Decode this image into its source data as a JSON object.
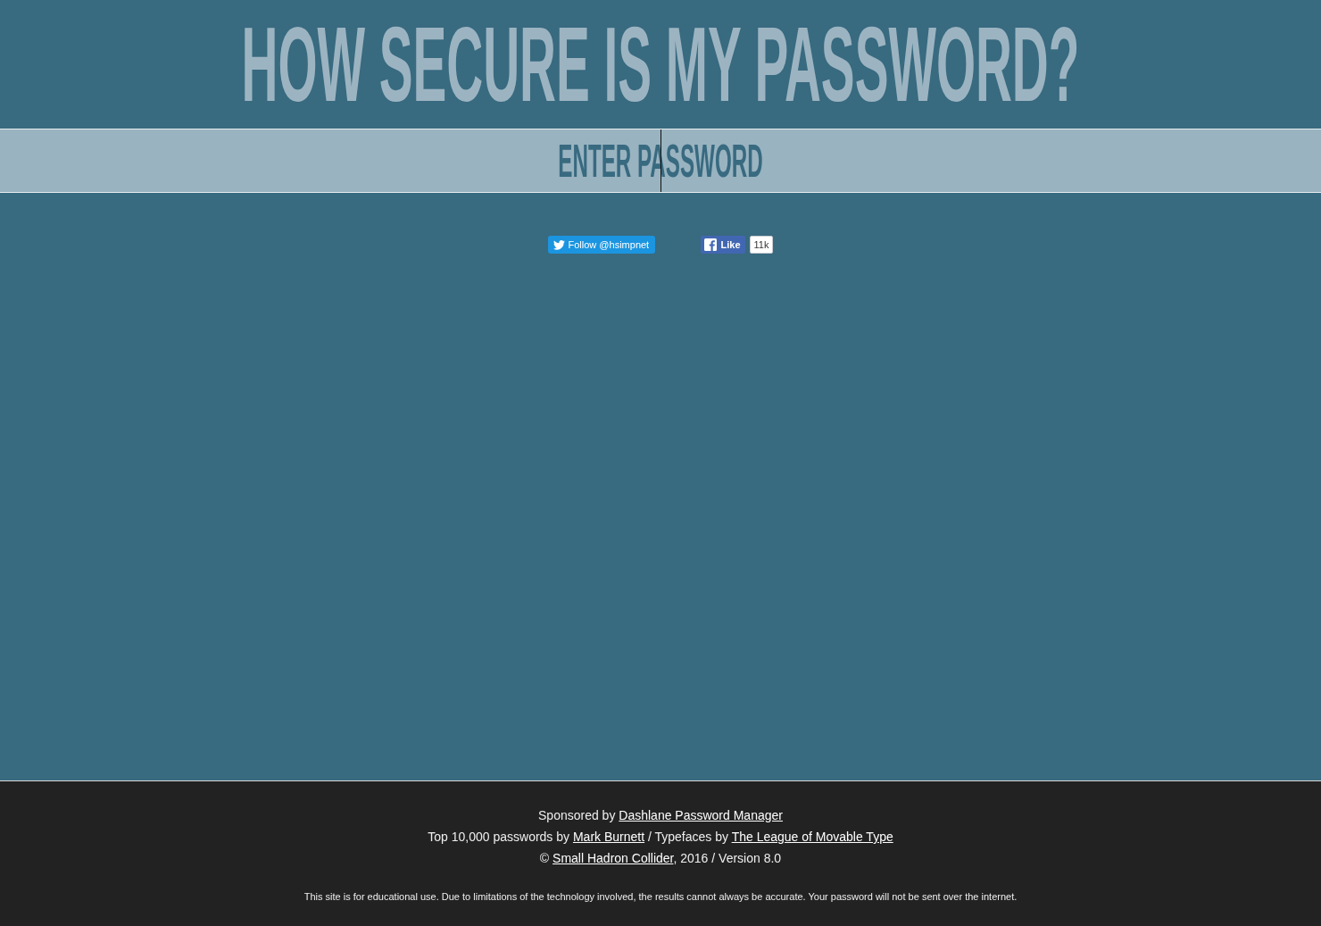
{
  "title": "HOW SECURE IS MY PASSWORD?",
  "password_field": {
    "placeholder": "ENTER PASSWORD",
    "focused": true
  },
  "social": {
    "follow_button": {
      "label": "Follow @hsimpnet"
    },
    "like_button": {
      "label": "Like",
      "count": "11k"
    }
  },
  "footer": {
    "lines": [
      {
        "parts": [
          {
            "kind": "text",
            "text": "Sponsored by "
          },
          {
            "kind": "link",
            "text": "Dashlane Password Manager"
          }
        ]
      },
      {
        "parts": [
          {
            "kind": "text",
            "text": "Top 10,000 passwords by "
          },
          {
            "kind": "link",
            "text": "Mark Burnett"
          },
          {
            "kind": "text",
            "text": " / Typefaces by "
          },
          {
            "kind": "link",
            "text": "The League of Movable Type"
          }
        ]
      },
      {
        "parts": [
          {
            "kind": "text",
            "text": "© "
          },
          {
            "kind": "link",
            "text": "Small Hadron Collider"
          },
          {
            "kind": "text",
            "text": ", 2016 / Version 8.0"
          }
        ]
      }
    ],
    "disclaimer": "This site is for educational use. Due to limitations of the technology involved, the results cannot always be accurate. Your password will not be sent over the internet."
  }
}
